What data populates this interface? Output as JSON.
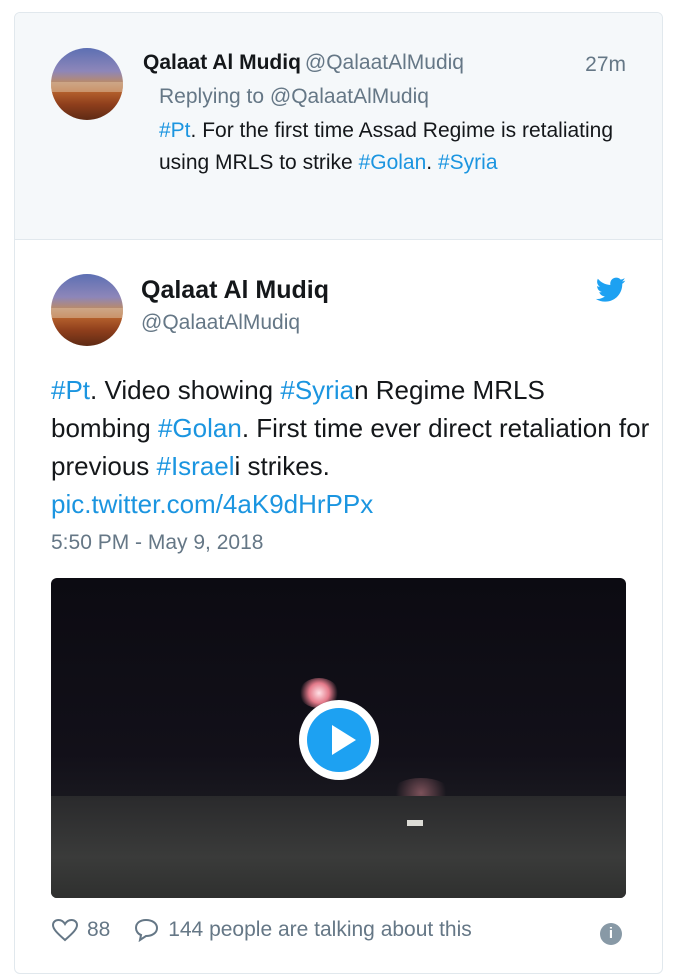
{
  "parent_tweet": {
    "name": "Qalaat Al Mudiq",
    "handle": "@QalaatAlMudiq",
    "time": "27m",
    "replying_to": "Replying to @QalaatAlMudiq",
    "text": [
      {
        "t": "#Pt",
        "tag": true
      },
      {
        "t": ". For the first time Assad Regime is retaliating using MRLS to strike ",
        "tag": false
      },
      {
        "t": "#Golan",
        "tag": true
      },
      {
        "t": ". ",
        "tag": false
      },
      {
        "t": "#Syria",
        "tag": true
      }
    ]
  },
  "main_tweet": {
    "name": "Qalaat Al Mudiq",
    "handle": "@QalaatAlMudiq",
    "text": [
      {
        "t": "#Pt",
        "tag": true
      },
      {
        "t": ". Video showing ",
        "tag": false
      },
      {
        "t": "#Syria",
        "tag": true
      },
      {
        "t": "n Regime MRLS bombing ",
        "tag": false
      },
      {
        "t": "#Golan",
        "tag": true
      },
      {
        "t": ". First time ever direct retaliation for previous ",
        "tag": false
      },
      {
        "t": "#Israel",
        "tag": true
      },
      {
        "t": "i strikes. ",
        "tag": false
      },
      {
        "t": "pic.twitter.com/4aK9dHrPPx",
        "tag": true
      }
    ],
    "timestamp": "5:50 PM - May 9, 2018",
    "likes": "88",
    "talking": "144 people are talking about this"
  },
  "colors": {
    "link": "#1b95e0",
    "play": "#1da1f2",
    "muted": "#657786"
  },
  "icons": [
    "twitter-bird-icon",
    "heart-icon",
    "comment-icon",
    "info-icon",
    "play-icon"
  ]
}
